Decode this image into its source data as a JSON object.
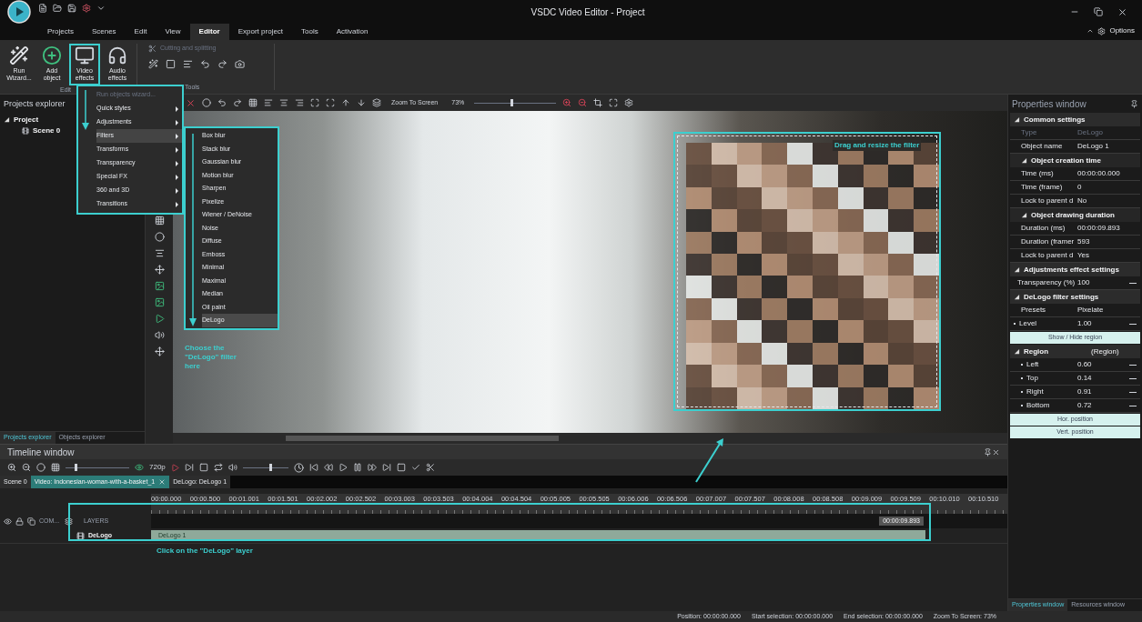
{
  "title_bar": {
    "title": "VSDC Video Editor - Project",
    "options": "Options"
  },
  "menu_tabs": [
    {
      "label": "Projects",
      "selected": false
    },
    {
      "label": "Scenes",
      "selected": false
    },
    {
      "label": "Edit",
      "selected": false
    },
    {
      "label": "View",
      "selected": false
    },
    {
      "label": "Editor",
      "selected": true
    },
    {
      "label": "Export project",
      "selected": false
    },
    {
      "label": "Tools",
      "selected": false
    },
    {
      "label": "Activation",
      "selected": false
    }
  ],
  "ribbon": {
    "buttons": [
      {
        "label": "Run Wizard...",
        "kind": "wand",
        "highlighted": false
      },
      {
        "label": "Add object",
        "kind": "add",
        "highlighted": false
      },
      {
        "label": "Video effects",
        "kind": "video",
        "highlighted": true
      },
      {
        "label": "Audio effects",
        "kind": "audio",
        "highlighted": false
      }
    ],
    "group_label": "Edit",
    "tools_title": "Cutting and splitting",
    "tools_label": "Tools"
  },
  "effects_menu": [
    {
      "label": "Run objects wizard...",
      "disabled": true,
      "selected": false
    },
    {
      "label": "Quick styles",
      "disabled": false,
      "selected": false
    },
    {
      "label": "Adjustments",
      "disabled": false,
      "selected": false
    },
    {
      "label": "Filters",
      "disabled": false,
      "selected": true
    },
    {
      "label": "Transforms",
      "disabled": false,
      "selected": false
    },
    {
      "label": "Transparency",
      "disabled": false,
      "selected": false
    },
    {
      "label": "Special FX",
      "disabled": false,
      "selected": false
    },
    {
      "label": "360 and 3D",
      "disabled": false,
      "selected": false
    },
    {
      "label": "Transitions",
      "disabled": false,
      "selected": false
    }
  ],
  "filters_menu": [
    {
      "label": "Box blur",
      "selected": false
    },
    {
      "label": "Stack blur",
      "selected": false
    },
    {
      "label": "Gaussian blur",
      "selected": false
    },
    {
      "label": "Motion blur",
      "selected": false
    },
    {
      "label": "Sharpen",
      "selected": false
    },
    {
      "label": "Pixelize",
      "selected": false
    },
    {
      "label": "Wiener / DeNoise",
      "selected": false
    },
    {
      "label": "Noise",
      "selected": false
    },
    {
      "label": "Diffuse",
      "selected": false
    },
    {
      "label": "Emboss",
      "selected": false
    },
    {
      "label": "Minimal",
      "selected": false
    },
    {
      "label": "Maximal",
      "selected": false
    },
    {
      "label": "Median",
      "selected": false
    },
    {
      "label": "Oil paint",
      "selected": false
    },
    {
      "label": "DeLogo",
      "selected": true
    }
  ],
  "projects_explorer": {
    "title": "Projects explorer",
    "tree": [
      {
        "label": "Project",
        "expanded": true,
        "children": [
          {
            "label": "Scene 0"
          }
        ]
      }
    ],
    "tabs": [
      {
        "label": "Projects explorer",
        "selected": true
      },
      {
        "label": "Objects explorer",
        "selected": false
      }
    ]
  },
  "preview": {
    "zoom_label": "Zoom To Screen",
    "zoom_value": "73%",
    "zoom_slider": {
      "level": 0.45
    }
  },
  "annotations": {
    "menu_hint": "Choose the \"DeLogo\" filter here",
    "drag_hint": "Drag and resize the filter",
    "layer_hint": "Click on the \"DeLogo\" layer"
  },
  "properties": {
    "title": "Properties window",
    "rows": [
      {
        "kind": "section",
        "label": "Common settings"
      },
      {
        "kind": "row",
        "label": "Type",
        "value": "DeLogo",
        "disabled": true
      },
      {
        "kind": "row",
        "label": "Object name",
        "value": "DeLogo 1",
        "disabled": false
      },
      {
        "kind": "subsection",
        "label": "Object creation time"
      },
      {
        "kind": "row",
        "label": "Time (ms)",
        "value": "00:00:00.000",
        "disabled": false
      },
      {
        "kind": "row",
        "label": "Time (frame)",
        "value": "0",
        "disabled": false
      },
      {
        "kind": "row",
        "label": "Lock to parent d",
        "value": "No",
        "disabled": false
      },
      {
        "kind": "subsection",
        "label": "Object drawing duration"
      },
      {
        "kind": "row",
        "label": "Duration (ms)",
        "value": "00:00:09.893",
        "disabled": false
      },
      {
        "kind": "row",
        "label": "Duration (framer",
        "value": "593",
        "disabled": false
      },
      {
        "kind": "row",
        "label": "Lock to parent d",
        "value": "Yes",
        "disabled": false
      },
      {
        "kind": "section",
        "label": "Adjustments effect settings"
      },
      {
        "kind": "slider",
        "label": "Transparency (%)",
        "value": "100"
      },
      {
        "kind": "section",
        "label": "DeLogo filter settings"
      },
      {
        "kind": "row",
        "label": "Presets",
        "value": "Pixelate",
        "disabled": false
      },
      {
        "kind": "slider",
        "label": "Level",
        "value": "1.00"
      },
      {
        "kind": "button",
        "label": "Show / Hide region"
      },
      {
        "kind": "section",
        "label": "Region",
        "value": "(Region)"
      },
      {
        "kind": "sub_slider",
        "label": "Left",
        "value": "0.60"
      },
      {
        "kind": "sub_slider",
        "label": "Top",
        "value": "0.14"
      },
      {
        "kind": "sub_slider",
        "label": "Right",
        "value": "0.91"
      },
      {
        "kind": "sub_slider",
        "label": "Bottom",
        "value": "0.72"
      },
      {
        "kind": "button",
        "label": "Hor. position"
      },
      {
        "kind": "button",
        "label": "Vert. position"
      }
    ],
    "tabs": [
      {
        "label": "Properties window",
        "selected": true
      },
      {
        "label": "Resources window",
        "selected": false
      }
    ]
  },
  "timeline": {
    "title": "Timeline window",
    "resolution": "720p",
    "zoom_slider": {
      "level": 0.15
    },
    "volume_slider": {
      "level": 0.6
    },
    "tabs": [
      {
        "label": "Scene 0",
        "selected": false,
        "closable": false
      },
      {
        "label": "Video: Indonesian-woman-with-a-basket_1",
        "selected": true,
        "closable": true
      },
      {
        "label": "DeLogo: DeLogo 1",
        "selected": false,
        "closable": false
      }
    ],
    "ruler": [
      "00:00.000",
      "00:00.500",
      "00:01.001",
      "00:01.501",
      "00:02.002",
      "00:02.502",
      "00:03.003",
      "00:03.503",
      "00:04.004",
      "00:04.504",
      "00:05.005",
      "00:05.505",
      "00:06.006",
      "00:06.506",
      "00:07.007",
      "00:07.507",
      "00:08.008",
      "00:08.508",
      "00:09.009",
      "00:09.509",
      "00:10.010",
      "00:10.510"
    ],
    "composition": "COM...",
    "layers_label": "LAYERS",
    "track": "DeLogo",
    "clip": "DeLogo 1",
    "end_time": "00:00:09.893"
  },
  "status_bar": [
    {
      "label": "Position:",
      "value": "00:00:00.000"
    },
    {
      "label": "Start selection:",
      "value": "00:00:00.000"
    },
    {
      "label": "End selection:",
      "value": "00:00:00.000"
    },
    {
      "label": "Zoom To Screen:",
      "value": "73%"
    }
  ]
}
